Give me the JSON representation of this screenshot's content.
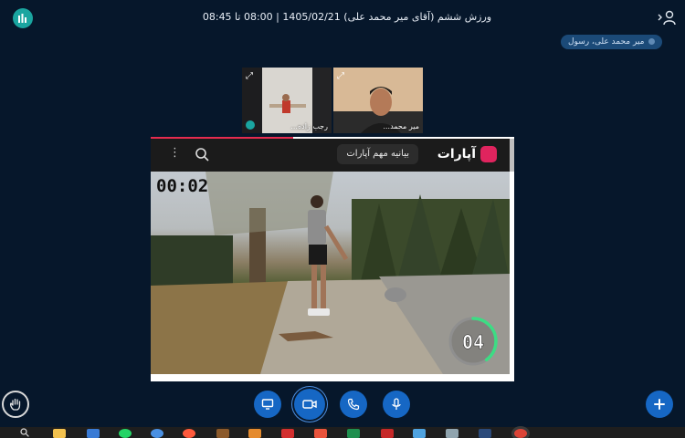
{
  "header": {
    "title": "ورزش ششم (آقای میر محمد علی) 1405/02/21 | 08:00 تا 08:45"
  },
  "presenter": {
    "name": "میر محمد علی، رسول"
  },
  "webcams": [
    {
      "name": "رجب زاده...",
      "bg": "#3e3a36"
    },
    {
      "name": "میر محمد...",
      "bg": "#caa583"
    }
  ],
  "video": {
    "site_name": "آپارات",
    "chip_label": "بیانیه مهم آپارات",
    "timer": "00:02",
    "reps": "04",
    "progress": 0.4
  },
  "colors": {
    "background": "#06172b",
    "accent": "#1667c4",
    "teal": "#1aa5a0",
    "brand": "#e0245e",
    "ring": "#3ddc84"
  },
  "icons": {
    "stats": "bar-chart-icon",
    "users": "users-icon",
    "share_screen": "monitor-icon",
    "camera": "video-camera-icon",
    "phone": "phone-icon",
    "mic": "microphone-icon",
    "hand": "raise-hand-icon",
    "plus": "plus-icon",
    "search": "search-icon",
    "menu": "kebab-menu-icon"
  }
}
